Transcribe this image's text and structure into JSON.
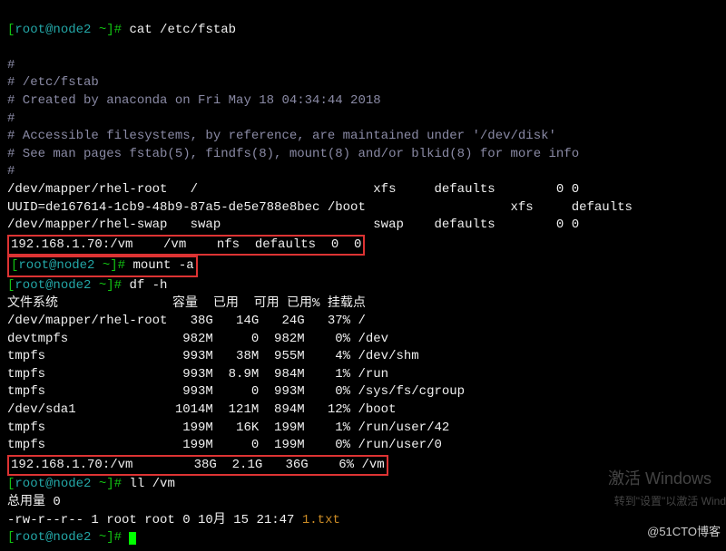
{
  "prompt_root": "[root@node2 ~]#",
  "cmd1": "cat /etc/fstab",
  "fstab": {
    "l1": "#",
    "l2": "# /etc/fstab",
    "l3": "# Created by anaconda on Fri May 18 04:34:44 2018",
    "l4": "#",
    "l5": "# Accessible filesystems, by reference, are maintained under '/dev/disk'",
    "l6": "# See man pages fstab(5), findfs(8), mount(8) and/or blkid(8) for more info",
    "l7": "#",
    "e1": "/dev/mapper/rhel-root   /                       xfs     defaults        0 0",
    "e2": "UUID=de167614-1cb9-48b9-87a5-de5e788e8bec /boot                   xfs     defaults",
    "e3": "/dev/mapper/rhel-swap   swap                    swap    defaults        0 0",
    "e4": "192.168.1.70:/vm    /vm    nfs  defaults  0  0"
  },
  "cmd2": "mount -a",
  "cmd3": "df -h",
  "df_header": "文件系统               容量  已用  可用 已用% 挂载点",
  "df_rows": {
    "r1": "/dev/mapper/rhel-root   38G   14G   24G   37% /",
    "r2": "devtmpfs               982M     0  982M    0% /dev",
    "r3": "tmpfs                  993M   38M  955M    4% /dev/shm",
    "r4": "tmpfs                  993M  8.9M  984M    1% /run",
    "r5": "tmpfs                  993M     0  993M    0% /sys/fs/cgroup",
    "r6": "/dev/sda1             1014M  121M  894M   12% /boot",
    "r7": "tmpfs                  199M   16K  199M    1% /run/user/42",
    "r8": "tmpfs                  199M     0  199M    0% /run/user/0",
    "r9": "192.168.1.70:/vm        38G  2.1G   36G    6% /vm"
  },
  "cmd4": "ll /vm",
  "ll_total": "总用量 0",
  "ll_row": {
    "perms": "-rw-r--r-- 1 root root 0 10月 15 21:47 ",
    "file": "1.txt"
  },
  "watermark": {
    "title": "激活 Windows",
    "sub": "转到\"设置\"以激活 Wind"
  },
  "footer": "@51CTO博客"
}
